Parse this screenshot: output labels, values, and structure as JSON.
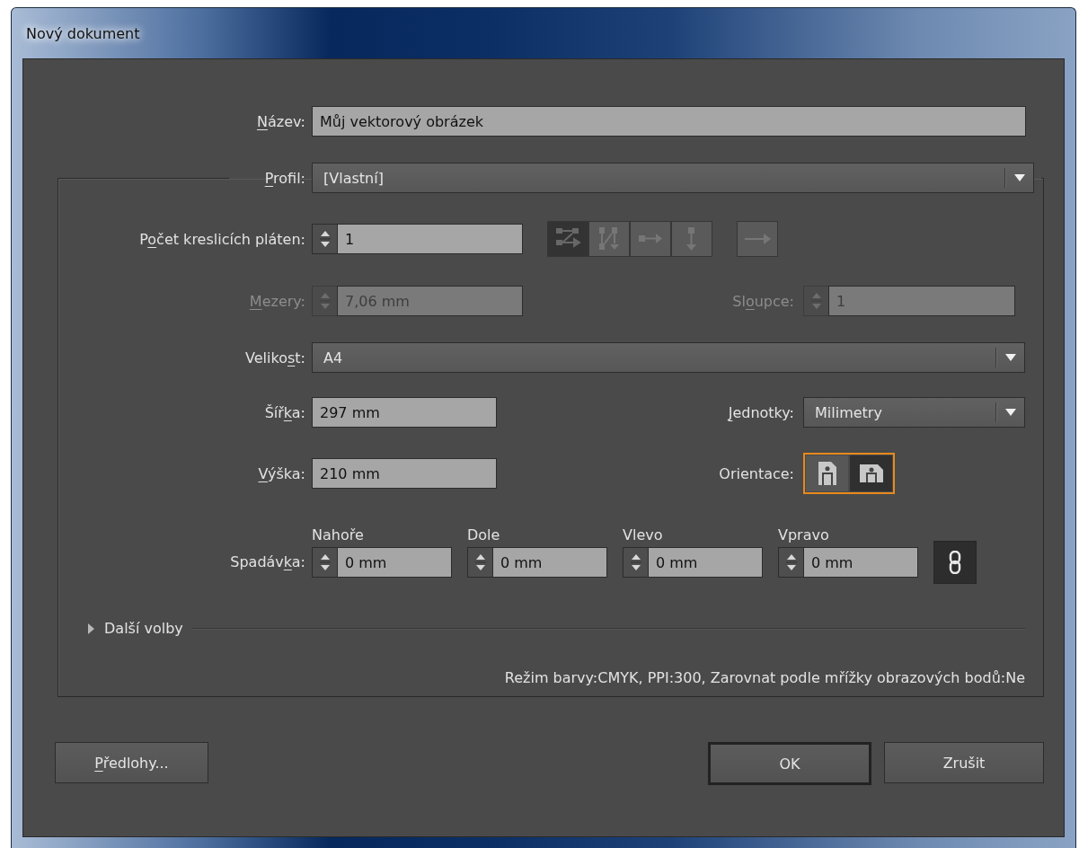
{
  "window": {
    "title": "Nový dokument"
  },
  "name": {
    "label": [
      {
        "text": "N",
        "underline": true
      },
      {
        "text": "ázev:",
        "underline": false
      }
    ],
    "value": "Můj vektorový obrázek"
  },
  "profile": {
    "label": [
      {
        "text": "P",
        "underline": true
      },
      {
        "text": "rofil:",
        "underline": false
      }
    ],
    "value": "[Vlastní]"
  },
  "artboards": {
    "label": [
      {
        "text": "P",
        "underline": false
      },
      {
        "text": "o",
        "underline": true
      },
      {
        "text": "čet kreslicích pláten:",
        "underline": false
      }
    ],
    "value": "1",
    "arrangement": [
      {
        "kind": "grid-by-row",
        "selected": true,
        "disabled": true
      },
      {
        "kind": "grid-by-column",
        "selected": false,
        "disabled": true
      },
      {
        "kind": "row",
        "selected": false,
        "disabled": true
      },
      {
        "kind": "column",
        "selected": false,
        "disabled": true
      }
    ],
    "direction": {
      "kind": "left-to-right",
      "disabled": true
    }
  },
  "spacing": {
    "label": [
      {
        "text": "M",
        "underline": true
      },
      {
        "text": "ezery:",
        "underline": false
      }
    ],
    "value": "7,06 mm",
    "disabled": true
  },
  "columns": {
    "label": [
      {
        "text": "Sl",
        "underline": false
      },
      {
        "text": "o",
        "underline": true
      },
      {
        "text": "upce:",
        "underline": false
      }
    ],
    "value": "1",
    "disabled": true
  },
  "size": {
    "label": [
      {
        "text": "Veliko",
        "underline": false
      },
      {
        "text": "s",
        "underline": true
      },
      {
        "text": "t:",
        "underline": false
      }
    ],
    "value": "A4"
  },
  "width": {
    "label": [
      {
        "text": "Šíř",
        "underline": false
      },
      {
        "text": "k",
        "underline": true
      },
      {
        "text": "a:",
        "underline": false
      }
    ],
    "value": "297 mm"
  },
  "units": {
    "label": [
      {
        "text": "J",
        "underline": true
      },
      {
        "text": "ednotky:",
        "underline": false
      }
    ],
    "value": "Milimetry"
  },
  "height": {
    "label": [
      {
        "text": "V",
        "underline": true
      },
      {
        "text": "ýška:",
        "underline": false
      }
    ],
    "value": "210 mm"
  },
  "orientation": {
    "label": [
      {
        "text": "Orientace:",
        "underline": false
      }
    ],
    "options": [
      {
        "kind": "portrait",
        "selected": false
      },
      {
        "kind": "landscape",
        "selected": true
      }
    ]
  },
  "bleed": {
    "label": [
      {
        "text": "Spadáv",
        "underline": false
      },
      {
        "text": "k",
        "underline": true
      },
      {
        "text": "a:",
        "underline": false
      }
    ],
    "fields": [
      {
        "heading": "Nahoře",
        "value": "0 mm"
      },
      {
        "heading": "Dole",
        "value": "0 mm"
      },
      {
        "heading": "Vlevo",
        "value": "0 mm"
      },
      {
        "heading": "Vpravo",
        "value": "0 mm"
      }
    ],
    "linked": true
  },
  "more_options": {
    "label": "Další volby",
    "expanded": false
  },
  "info": "Režim barvy:CMYK, PPI:300, Zarovnat podle mřížky obrazových bodů:Ne",
  "buttons": [
    {
      "kind": "templates",
      "label": [
        {
          "text": "P",
          "underline": true
        },
        {
          "text": "ředlohy...",
          "underline": false
        }
      ],
      "default": false
    },
    {
      "kind": "ok",
      "label": [
        {
          "text": "OK",
          "underline": false
        }
      ],
      "default": true
    },
    {
      "kind": "cancel",
      "label": [
        {
          "text": "Zrušit",
          "underline": false
        }
      ],
      "default": false
    }
  ]
}
